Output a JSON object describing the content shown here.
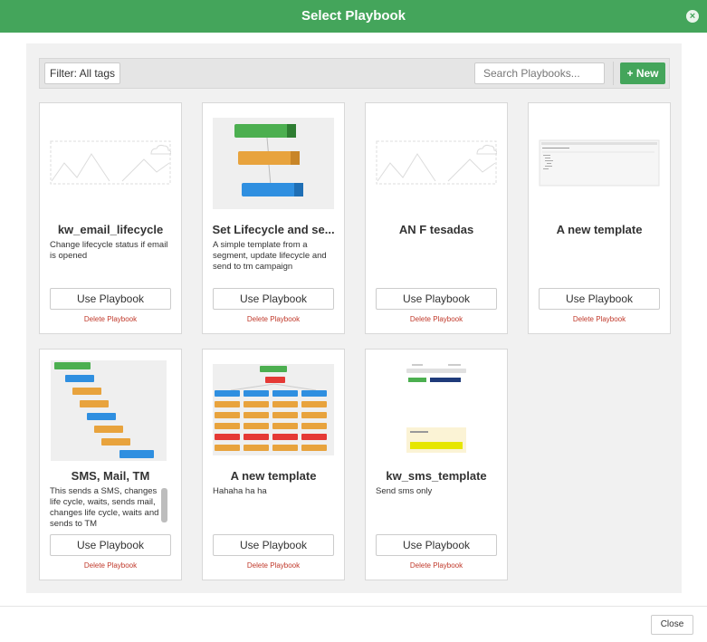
{
  "modal": {
    "title": "Select Playbook",
    "close_icon": "×",
    "footer_close": "Close"
  },
  "toolbar": {
    "filter_label": "Filter: All tags",
    "search_placeholder": "Search Playbooks...",
    "new_label": "+ New"
  },
  "colors": {
    "header": "#44a55b",
    "delete_link": "#c0392b",
    "node_green": "#4caf50",
    "node_orange": "#e8a33d",
    "node_blue": "#2f8fe0",
    "node_red": "#e53935"
  },
  "cards": [
    {
      "title": "kw_email_lifecycle",
      "description": "Change lifecycle status if email is opened",
      "thumbnail": "placeholder-image-icon",
      "use_label": "Use Playbook",
      "delete_label": "Delete Playbook"
    },
    {
      "title": "Set Lifecycle and se...",
      "description": "A simple template from a segment, update lifecycle and send to tm campaign",
      "thumbnail": "flow-diagram",
      "use_label": "Use Playbook",
      "delete_label": "Delete Playbook"
    },
    {
      "title": "AN F tesadas",
      "description": "",
      "thumbnail": "placeholder-image-icon",
      "use_label": "Use Playbook",
      "delete_label": "Delete Playbook"
    },
    {
      "title": "A new template",
      "description": "",
      "thumbnail": "document-preview",
      "use_label": "Use Playbook",
      "delete_label": "Delete Playbook"
    },
    {
      "title": "SMS, Mail, TM",
      "description": "This sends a SMS, changes life cycle, waits, sends mail, changes life cycle, waits and sends to TM",
      "thumbnail": "flow-diagram",
      "use_label": "Use Playbook",
      "delete_label": "Delete Playbook"
    },
    {
      "title": "A new template",
      "description": "Hahaha ha ha",
      "thumbnail": "flow-diagram",
      "use_label": "Use Playbook",
      "delete_label": "Delete Playbook"
    },
    {
      "title": "kw_sms_template",
      "description": "Send sms only",
      "thumbnail": "sms-preview",
      "use_label": "Use Playbook",
      "delete_label": "Delete Playbook"
    }
  ]
}
